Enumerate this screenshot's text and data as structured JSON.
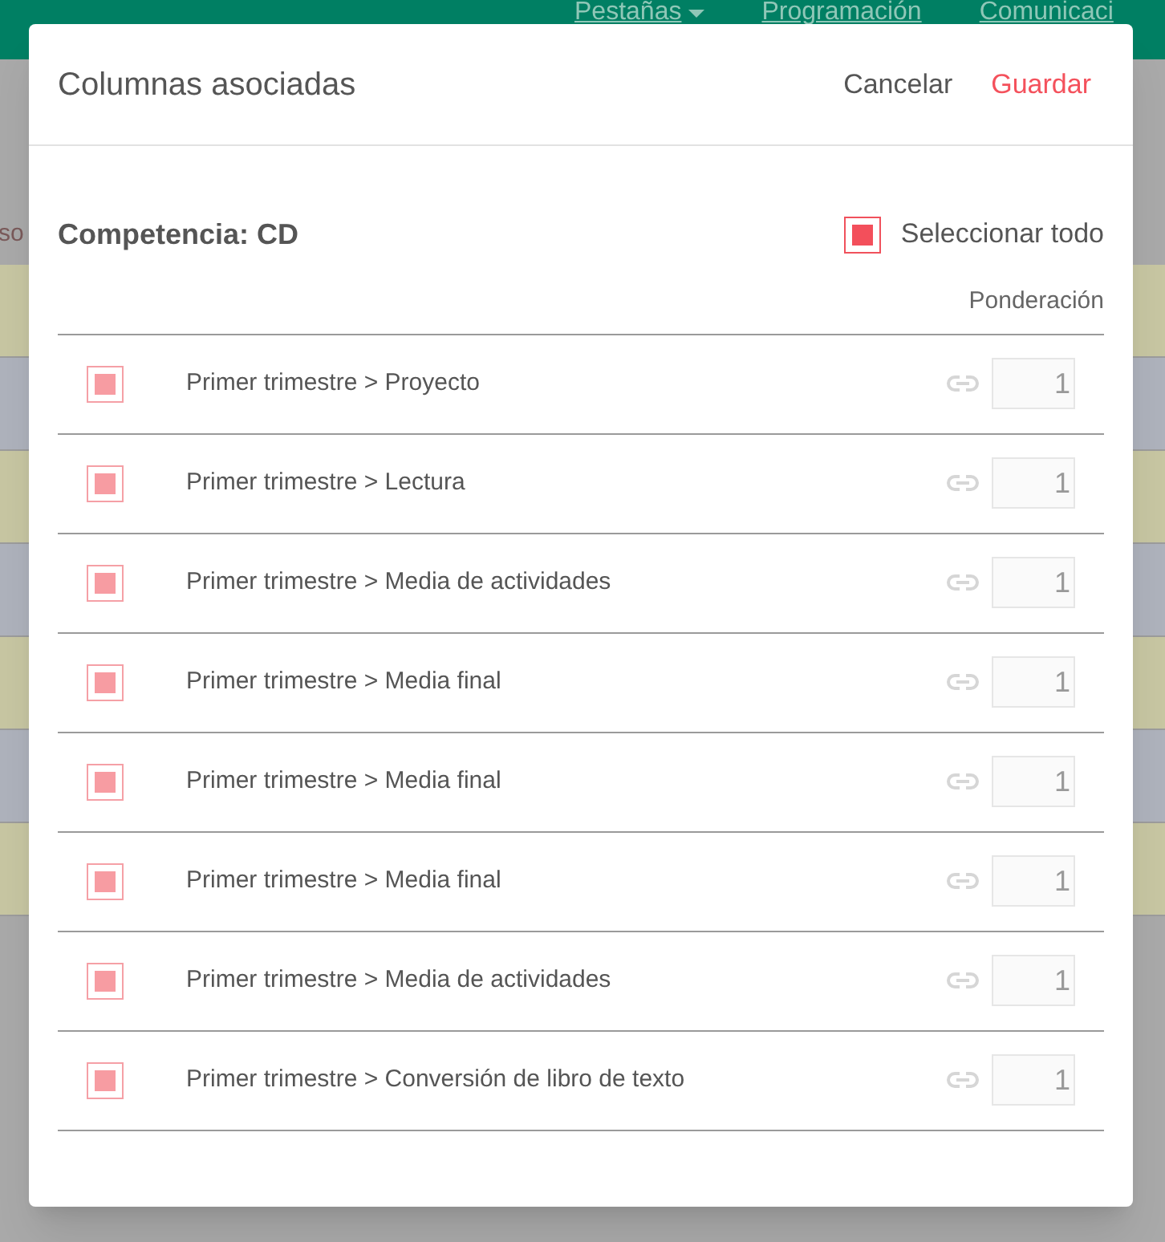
{
  "background": {
    "nav": [
      {
        "label": "Pestañas",
        "dropdown": true
      },
      {
        "label": "Programación",
        "dropdown": false
      },
      {
        "label": "Comunicaci",
        "dropdown": false
      }
    ],
    "side_text": "so"
  },
  "dialog": {
    "title": "Columnas asociadas",
    "cancel": "Cancelar",
    "save": "Guardar",
    "competence": "Competencia: CD",
    "select_all": {
      "label": "Seleccionar todo",
      "checked": true
    },
    "weight_header": "Ponderación",
    "rows": [
      {
        "label": "Primer trimestre > Proyecto",
        "checked": true,
        "disabled": true,
        "weight": "1"
      },
      {
        "label": "Primer trimestre > Lectura",
        "checked": true,
        "disabled": true,
        "weight": "1"
      },
      {
        "label": "Primer trimestre > Media de actividades",
        "checked": true,
        "disabled": true,
        "weight": "1"
      },
      {
        "label": "Primer trimestre > Media final",
        "checked": true,
        "disabled": true,
        "weight": "1"
      },
      {
        "label": "Primer trimestre > Media final",
        "checked": true,
        "disabled": true,
        "weight": "1"
      },
      {
        "label": "Primer trimestre > Media final",
        "checked": true,
        "disabled": true,
        "weight": "1"
      },
      {
        "label": "Primer trimestre > Media de actividades",
        "checked": true,
        "disabled": true,
        "weight": "1"
      },
      {
        "label": "Primer trimestre > Conversión de libro de texto",
        "checked": true,
        "disabled": true,
        "weight": "1"
      }
    ]
  }
}
